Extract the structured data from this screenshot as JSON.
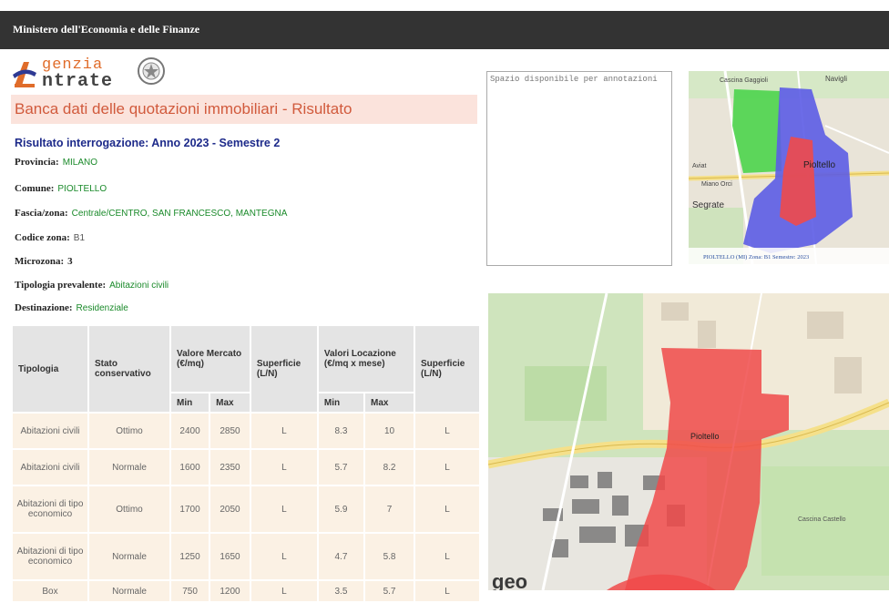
{
  "header": {
    "title": "Ministero dell'Economia e delle Finanze"
  },
  "logo": {
    "agenzia": "genzia",
    "entrate": "ntrate"
  },
  "page_title": "Banca dati delle quotazioni immobiliari - Risultato",
  "result_title": "Risultato interrogazione: Anno 2023 - Semestre 2",
  "fields": {
    "provincia": {
      "label": "Provincia:",
      "value": "MILANO"
    },
    "comune": {
      "label": "Comune:",
      "value": "PIOLTELLO"
    },
    "fascia": {
      "label": "Fascia/zona:",
      "value": "Centrale/CENTRO, SAN FRANCESCO, MANTEGNA"
    },
    "codice": {
      "label": "Codice zona:",
      "value": "B1"
    },
    "microzona": {
      "label": "Microzona:",
      "value": "3"
    },
    "tipologia_prevalente": {
      "label": "Tipologia prevalente:",
      "value": "Abitazioni civili"
    },
    "destinazione": {
      "label": "Destinazione:",
      "value": "Residenziale"
    }
  },
  "table": {
    "headers": {
      "tipologia": "Tipologia",
      "stato": "Stato conservativo",
      "valore_mercato": "Valore Mercato (€/mq)",
      "superficie1": "Superficie (L/N)",
      "valori_locazione": "Valori Locazione (€/mq x mese)",
      "superficie2": "Superficie (L/N)",
      "min": "Min",
      "max": "Max"
    },
    "rows": [
      {
        "tipologia": "Abitazioni civili",
        "stato": "Ottimo",
        "vmin": "2400",
        "vmax": "2850",
        "sup1": "L",
        "lmin": "8.3",
        "lmax": "10",
        "sup2": "L"
      },
      {
        "tipologia": "Abitazioni civili",
        "stato": "Normale",
        "vmin": "1600",
        "vmax": "2350",
        "sup1": "L",
        "lmin": "5.7",
        "lmax": "8.2",
        "sup2": "L"
      },
      {
        "tipologia": "Abitazioni di tipo economico",
        "stato": "Ottimo",
        "vmin": "1700",
        "vmax": "2050",
        "sup1": "L",
        "lmin": "5.9",
        "lmax": "7",
        "sup2": "L"
      },
      {
        "tipologia": "Abitazioni di tipo economico",
        "stato": "Normale",
        "vmin": "1250",
        "vmax": "1650",
        "sup1": "L",
        "lmin": "4.7",
        "lmax": "5.8",
        "sup2": "L"
      },
      {
        "tipologia": "Box",
        "stato": "Normale",
        "vmin": "750",
        "vmax": "1200",
        "sup1": "L",
        "lmin": "3.5",
        "lmax": "5.7",
        "sup2": "L"
      }
    ]
  },
  "notes": {
    "placeholder": "Spazio disponibile per annotazioni"
  },
  "minimap": {
    "labels": {
      "pioltello": "Pioltello",
      "segrate": "Segrate",
      "navigli": "Navigli",
      "cascina": "Cascina Gaggioli",
      "miano": "Miano Orci",
      "aviat": "Aviat"
    },
    "caption": "PIOLTELLO (MI) Zona: B1 Semestre: 2023"
  },
  "bigmap": {
    "labels": {
      "pioltello": "Pioltello",
      "cascina": "Cascina Castello",
      "watermark": "geo"
    }
  },
  "colors": {
    "topbar": "#333333",
    "title_bg": "#fbe3dc",
    "title_text": "#d15a3c",
    "result_text": "#1d2a8a",
    "value_green": "#1a8a2a",
    "zone_red": "#f04a4a",
    "zone_blue": "#5c5ce6",
    "zone_green": "#4cd44c"
  }
}
